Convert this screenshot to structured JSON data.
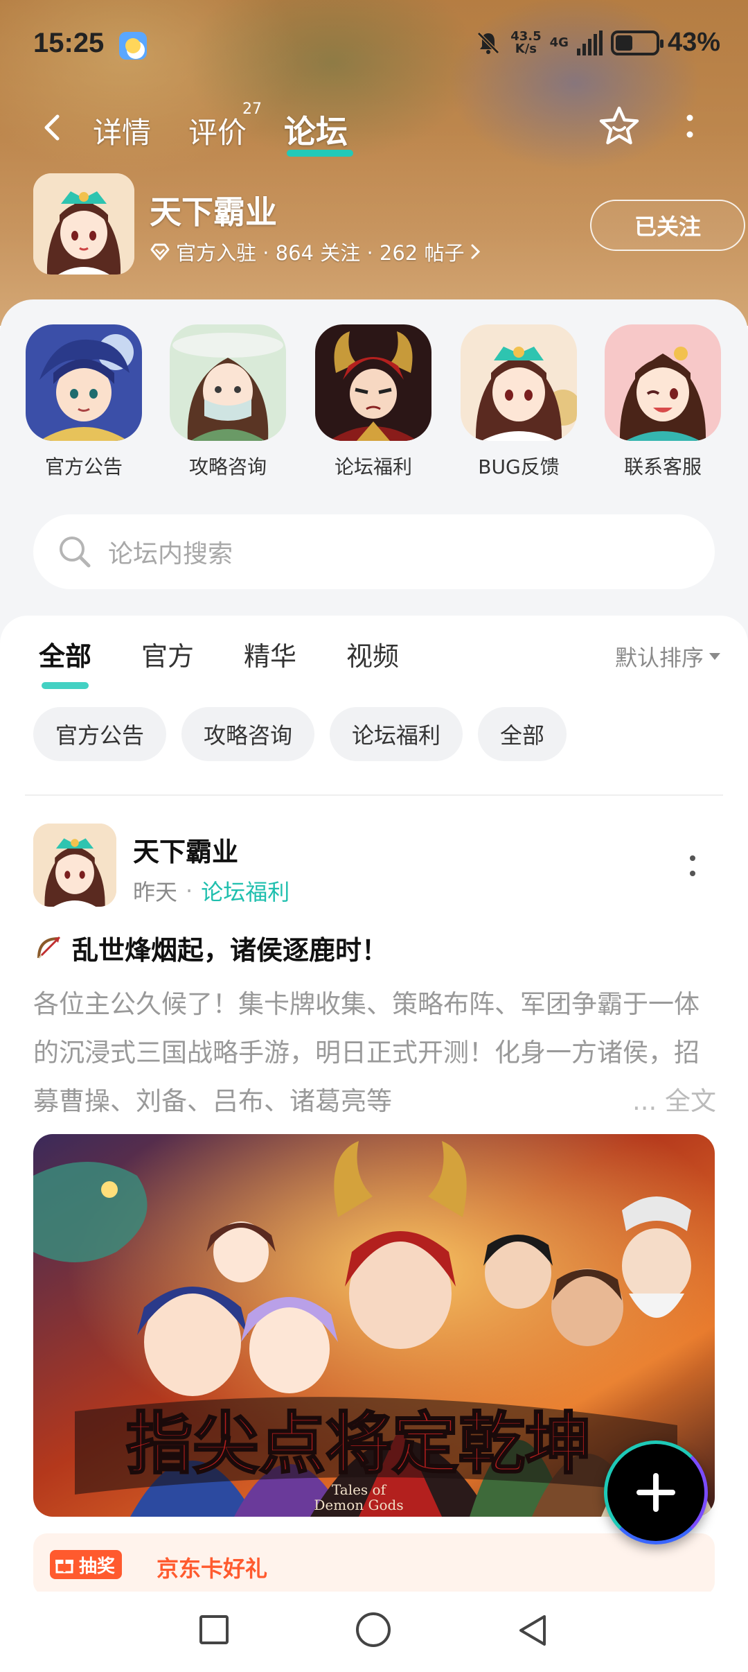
{
  "status_bar": {
    "time": "15:25",
    "net_speed_value": "43.5",
    "net_speed_unit": "K/s",
    "network": "4G",
    "battery_level": 0.43,
    "battery_pct": "43%"
  },
  "nav": {
    "tabs": [
      {
        "label": "详情"
      },
      {
        "label": "评价",
        "badge": "27"
      },
      {
        "label": "论坛",
        "active": true
      }
    ]
  },
  "game": {
    "title": "天下霸业",
    "meta": "官方入驻 · 864 关注 · 262 帖子",
    "follow_label": "已关注"
  },
  "shortcuts": [
    {
      "label": "官方公告",
      "icon": "blue-warrior-avatar"
    },
    {
      "label": "攻略咨询",
      "icon": "masked-lady-avatar"
    },
    {
      "label": "论坛福利",
      "icon": "red-armored-general-avatar"
    },
    {
      "label": "BUG反馈",
      "icon": "princess-avatar"
    },
    {
      "label": "联系客服",
      "icon": "smiling-lady-avatar"
    }
  ],
  "search": {
    "placeholder": "论坛内搜索"
  },
  "feed": {
    "tabs": [
      "全部",
      "官方",
      "精华",
      "视频"
    ],
    "active_tab": "全部",
    "sort_label": "默认排序",
    "chips": [
      "官方公告",
      "攻略咨询",
      "论坛福利",
      "全部"
    ]
  },
  "post": {
    "author": "天下霸业",
    "time": "昨天",
    "board": "论坛福利",
    "title": "乱世烽烟起，诸侯逐鹿时！",
    "body": "各位主公久候了！集卡牌收集、策略布阵、军团争霸于一体的沉浸式三国战略手游，明日正式开测！化身一方诸侯，招募曹操、刘备、吕布、诸葛亮等",
    "full_text_label": "... 全文",
    "image_caption": "指尖点将定乾坤",
    "image_subcaption_1": "Tales of",
    "image_subcaption_2": "Demon Gods",
    "lottery_tag": "抽奖",
    "lottery_text": "京东卡好礼"
  },
  "colors": {
    "accent": "#22c9b8",
    "board_link": "#1fbfae",
    "lottery": "#ff5a2e"
  }
}
